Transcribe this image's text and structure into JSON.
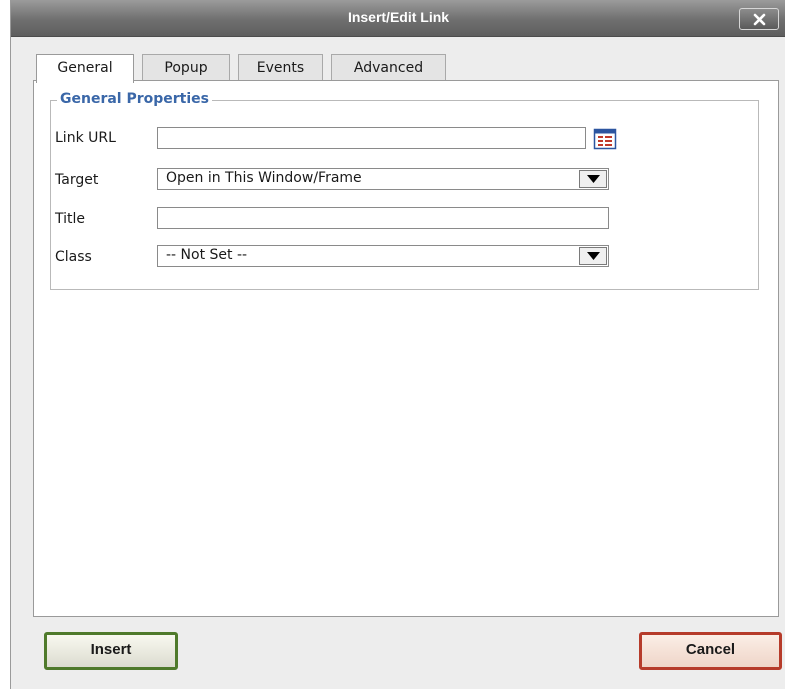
{
  "dialog": {
    "title": "Insert/Edit Link",
    "close_icon": "close-icon"
  },
  "tabs": [
    {
      "label": "General",
      "active": true
    },
    {
      "label": "Popup",
      "active": false
    },
    {
      "label": "Events",
      "active": false
    },
    {
      "label": "Advanced",
      "active": false
    }
  ],
  "general": {
    "legend": "General Properties",
    "link_url": {
      "label": "Link URL",
      "value": "",
      "browse_icon": "browse-icon"
    },
    "target": {
      "label": "Target",
      "selected": "Open in This Window/Frame"
    },
    "title": {
      "label": "Title",
      "value": ""
    },
    "class": {
      "label": "Class",
      "selected": "-- Not Set --"
    }
  },
  "buttons": {
    "insert": "Insert",
    "cancel": "Cancel"
  },
  "colors": {
    "legend": "#3a67a8",
    "insert_border": "#4f7a2b",
    "cancel_border": "#b63b2a",
    "titlebar": "#6f6f6f"
  }
}
